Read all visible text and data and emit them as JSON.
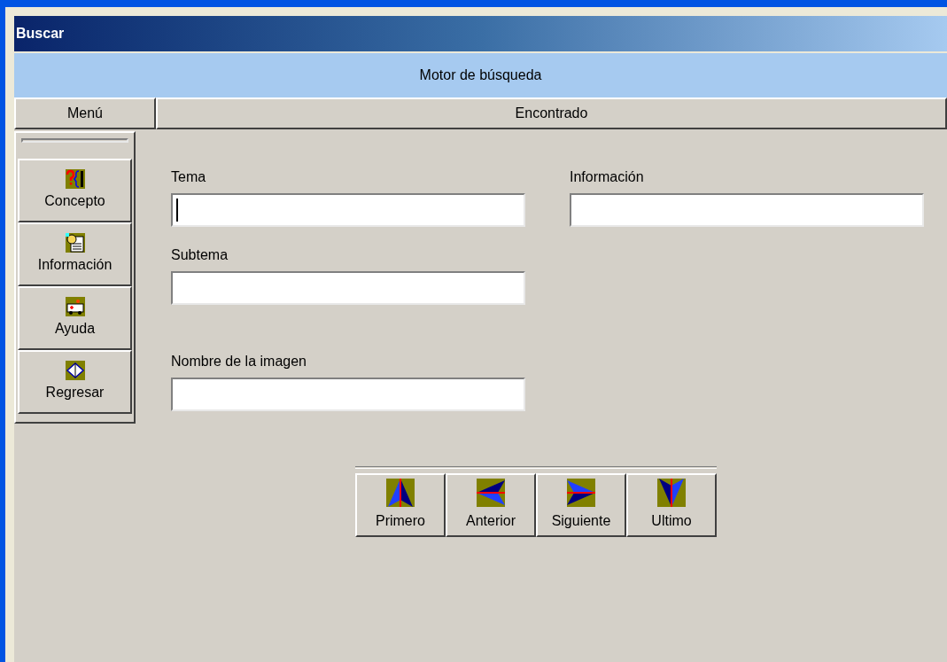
{
  "window": {
    "title": "Buscar"
  },
  "banner": "Motor de búsqueda",
  "headers": [
    "Menú",
    "Encontrado"
  ],
  "menu": [
    {
      "kind": "concept",
      "label": "Concepto"
    },
    {
      "kind": "info",
      "label": "Información"
    },
    {
      "kind": "help",
      "label": "Ayuda"
    },
    {
      "kind": "back",
      "label": "Regresar"
    }
  ],
  "fields": {
    "left": [
      {
        "label": "Tema",
        "focused": true
      },
      {
        "label": "Subtema",
        "focused": false
      },
      {
        "label": "Nombre de la imagen",
        "focused": false
      }
    ],
    "right": [
      {
        "label": "Información",
        "focused": false
      }
    ]
  },
  "navigation": [
    {
      "kind": "first",
      "label": "Primero"
    },
    {
      "kind": "prev",
      "label": "Anterior"
    },
    {
      "kind": "next",
      "label": "Siguiente"
    },
    {
      "kind": "last",
      "label": "Ultimo"
    }
  ]
}
